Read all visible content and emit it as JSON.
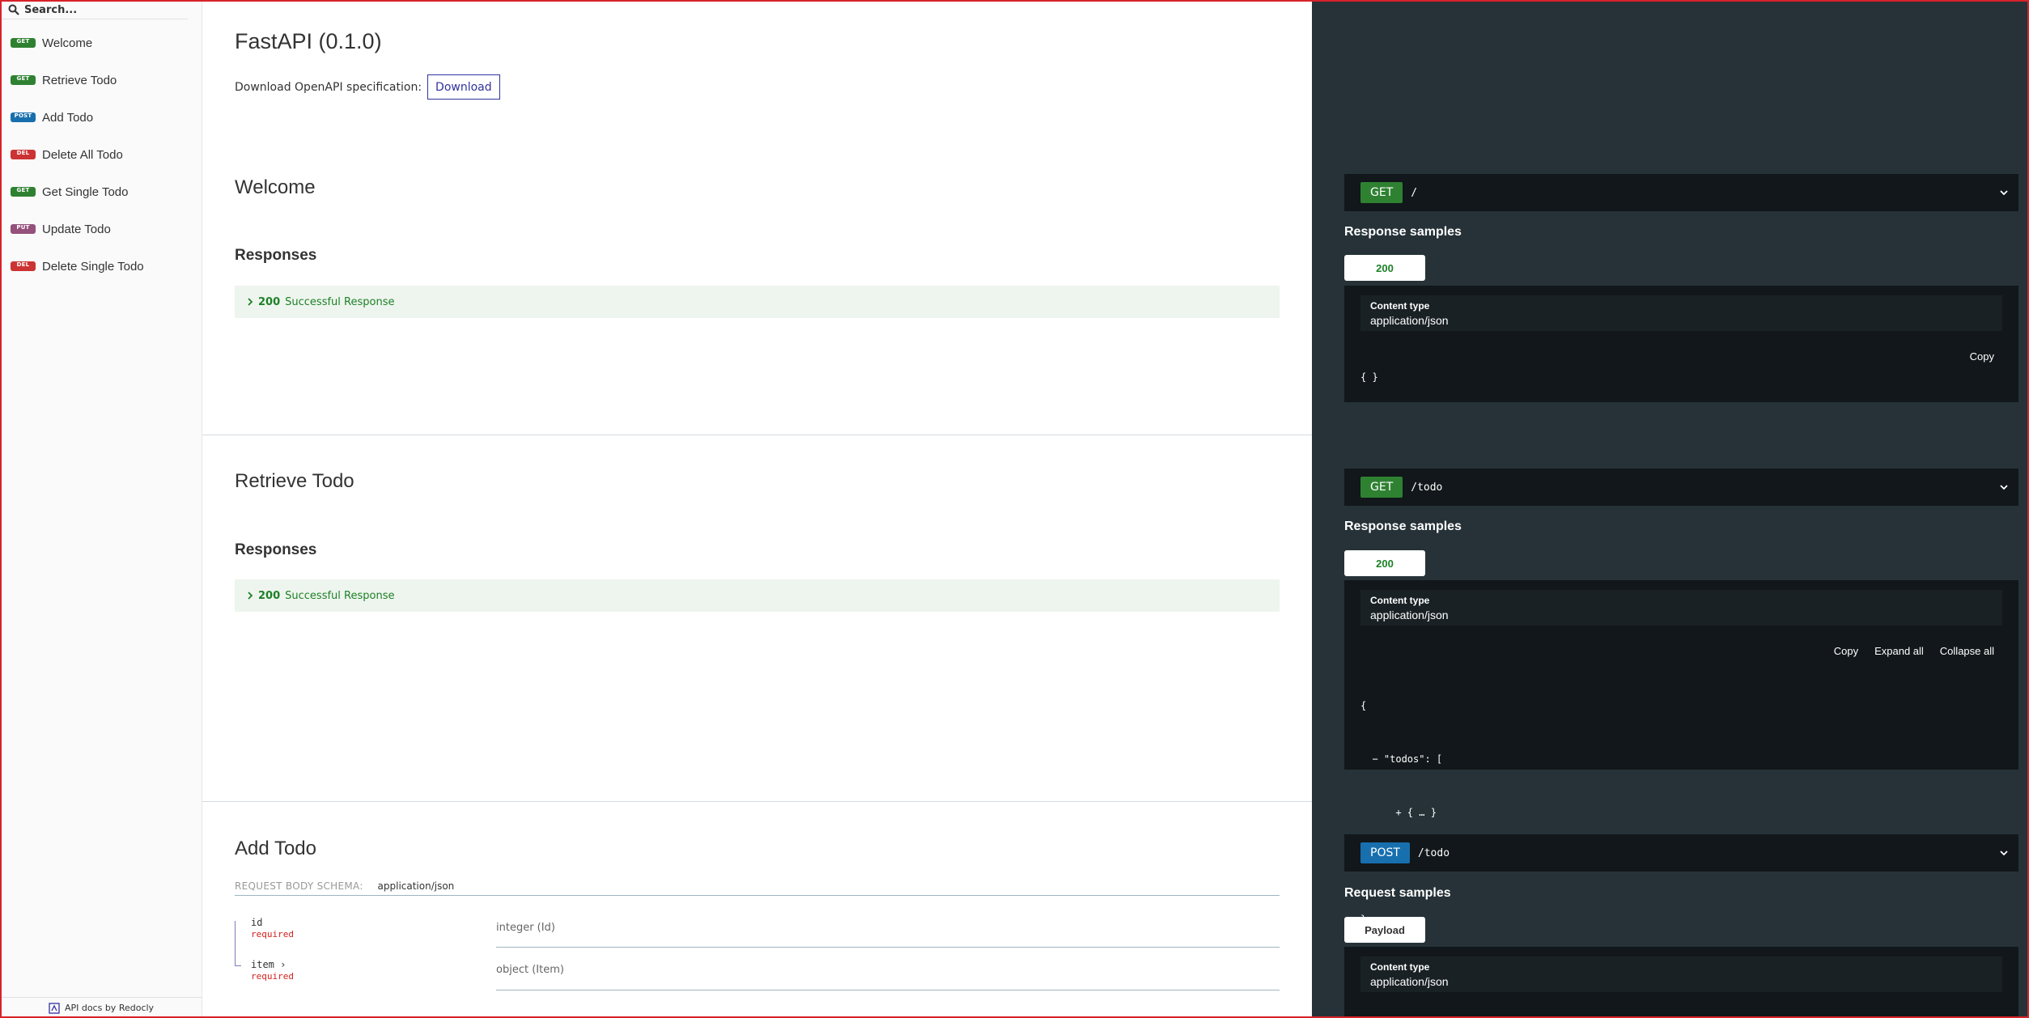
{
  "colors": {
    "get": "#2f8132",
    "post": "#186fae",
    "delete": "#cc3333",
    "put": "#95507c",
    "right_panel": "#263238",
    "success": "#1d8127"
  },
  "sidebar": {
    "search_placeholder": "Search...",
    "items": [
      {
        "method": "GET",
        "label": "Welcome"
      },
      {
        "method": "GET",
        "label": "Retrieve Todo"
      },
      {
        "method": "POST",
        "label": "Add Todo"
      },
      {
        "method": "DEL",
        "label": "Delete All Todo"
      },
      {
        "method": "GET",
        "label": "Get Single Todo"
      },
      {
        "method": "PUT",
        "label": "Update Todo"
      },
      {
        "method": "DEL",
        "label": "Delete Single Todo"
      }
    ],
    "footer": "API docs by Redocly"
  },
  "main": {
    "title": "FastAPI (0.1.0)",
    "spec_label": "Download OpenAPI specification:",
    "download_label": "Download",
    "sections": [
      {
        "title": "Welcome",
        "responses_label": "Responses",
        "response": {
          "code": "200",
          "text": "Successful Response"
        }
      },
      {
        "title": "Retrieve Todo",
        "responses_label": "Responses",
        "response": {
          "code": "200",
          "text": "Successful Response"
        }
      },
      {
        "title": "Add Todo",
        "schema_label": "REQUEST BODY SCHEMA:",
        "schema_type": "application/json",
        "fields": [
          {
            "name": "id",
            "required": "required",
            "type": "integer (Id)"
          },
          {
            "name": "item",
            "required": "required",
            "type": "object (Item)"
          }
        ]
      }
    ]
  },
  "right": {
    "panels": [
      {
        "method": "GET",
        "path": "/",
        "samples_title": "Response samples",
        "tab": "200",
        "content_type_label": "Content type",
        "content_type": "application/json",
        "tools": [
          "Copy"
        ],
        "json_lines": [
          "{ }"
        ]
      },
      {
        "method": "GET",
        "path": "/todo",
        "samples_title": "Response samples",
        "tab": "200",
        "content_type_label": "Content type",
        "content_type": "application/json",
        "tools": [
          "Copy",
          "Expand all",
          "Collapse all"
        ],
        "json_lines": [
          "{",
          "  − \"todos\": [",
          "      + { … }",
          "    ]",
          "}"
        ]
      },
      {
        "method": "POST",
        "path": "/todo",
        "samples_title": "Request samples",
        "tab": "Payload",
        "content_type_label": "Content type",
        "content_type": "application/json"
      }
    ]
  }
}
